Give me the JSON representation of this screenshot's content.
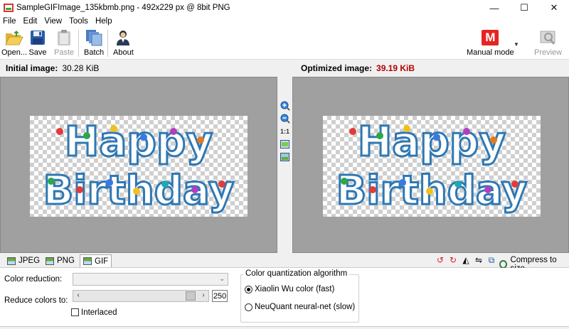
{
  "window": {
    "title": "SampleGIFImage_135kbmb.png - 492x229 px @ 8bit PNG",
    "minimize_glyph": "—",
    "maximize_glyph": "☐",
    "close_glyph": "✕"
  },
  "menu": [
    "File",
    "Edit",
    "View",
    "Tools",
    "Help"
  ],
  "toolbar": {
    "open": "Open...",
    "save": "Save",
    "paste": "Paste",
    "batch": "Batch",
    "about": "About",
    "mode_letter": "M",
    "mode_label": "Manual mode",
    "preview": "Preview",
    "accent_color": "#e52521"
  },
  "info": {
    "initial_label": "Initial image:",
    "initial_size": "30.28 KiB",
    "optimized_label": "Optimized image:",
    "optimized_size": "39.19 KiB"
  },
  "zoom": {
    "zoom_in_icon": "zoom-in-icon",
    "zoom_out_icon": "zoom-out-icon",
    "actual_size": "1:1",
    "fit_icon": "fit-window-icon",
    "compare_icon": "compare-icon"
  },
  "image_text": {
    "line1": "Happy",
    "line2": "Birthday"
  },
  "formats": {
    "tabs": [
      "JPEG",
      "PNG",
      "GIF"
    ],
    "active": "GIF",
    "compress_label": "Compress to size"
  },
  "settings": {
    "color_reduction_label": "Color reduction:",
    "color_reduction_value": "",
    "reduce_colors_label": "Reduce colors to:",
    "reduce_colors_value": "250",
    "slider_level": 0.96,
    "interlaced_label": "Interlaced",
    "interlaced_checked": false,
    "quant_title": "Color quantization algorithm",
    "quant_options": [
      "Xiaolin Wu color (fast)",
      "NeuQuant neural-net (slow)"
    ],
    "quant_selected": 0
  }
}
